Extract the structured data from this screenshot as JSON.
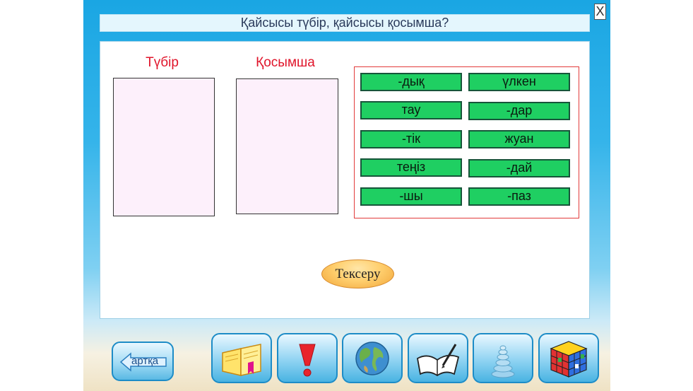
{
  "title": "Қайсысы түбір, қайсысы қосымша?",
  "close_icon_text": "X",
  "columns": {
    "root_label": "Түбір",
    "suffix_label": "Қосымша"
  },
  "chips": [
    "-дық",
    "үлкен",
    "тау",
    "-дар",
    "-тік",
    "жуан",
    "теңіз",
    "-дай",
    "-шы",
    "-паз"
  ],
  "check_button": "Тексеру",
  "back_button": "артқа",
  "nav_icons": [
    "book-icon",
    "exclamation-icon",
    "globe-icon",
    "notebook-pen-icon",
    "stones-icon",
    "rubik-cube-icon"
  ],
  "colors": {
    "chip_green": "#1fcf62",
    "label_red": "#e0142a",
    "sky_blue": "#1aa6e3"
  }
}
